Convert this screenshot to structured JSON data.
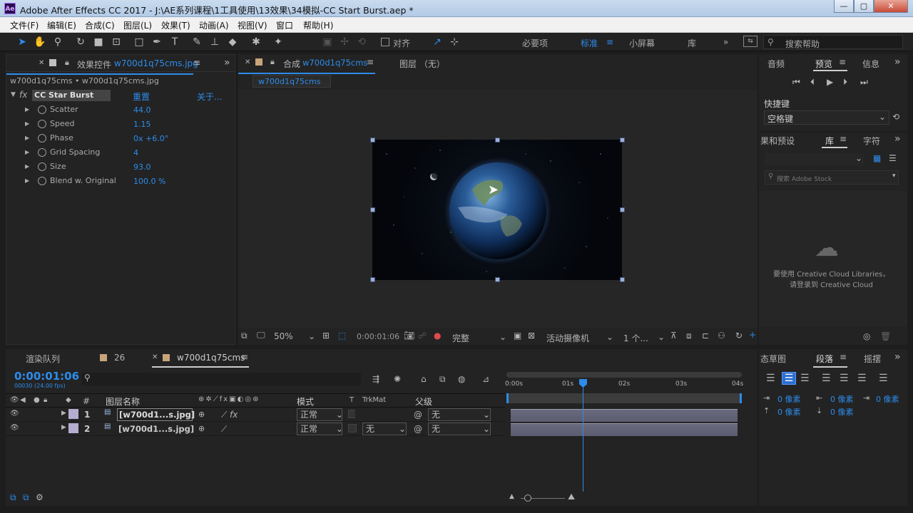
{
  "titlebar": {
    "title": "Adobe After Effects CC 2017 - J:\\AE系列课程\\1工具使用\\13效果\\34模拟-CC Start Burst.aep *",
    "icon": "Ae",
    "minimize": "—",
    "maximize": "▢",
    "close": "✕"
  },
  "menu": [
    "文件(F)",
    "编辑(E)",
    "合成(C)",
    "图层(L)",
    "效果(T)",
    "动画(A)",
    "视图(V)",
    "窗口",
    "帮助(H)"
  ],
  "toolbar": {
    "align_label": "对齐",
    "workspaces": [
      "必要项",
      "标准",
      "小屏幕",
      "库"
    ],
    "active_workspace": "标准",
    "search_placeholder": "搜索帮助"
  },
  "effect_panel": {
    "tab_prefix": "效果控件",
    "tab_name": "w700d1q75cms.jpg",
    "breadcrumb": "w700d1q75cms • w700d1q75cms.jpg",
    "effect_name": "CC Star Burst",
    "reset": "重置",
    "about": "关于...",
    "params": [
      {
        "name": "Scatter",
        "value": "44.0"
      },
      {
        "name": "Speed",
        "value": "1.15"
      },
      {
        "name": "Phase",
        "value": "0x +6.0°"
      },
      {
        "name": "Grid Spacing",
        "value": "4"
      },
      {
        "name": "Size",
        "value": "93.0"
      },
      {
        "name": "Blend w. Original",
        "value": "100.0 %"
      }
    ]
  },
  "comp_panel": {
    "tab_prefix": "合成",
    "tab_name": "w700d1q75cms",
    "layer_tab": "图层 （无）",
    "subtab": "w700d1q75cms",
    "zoom": "50%",
    "timecode": "0:00:01:06",
    "resolution": "完整",
    "camera": "活动摄像机",
    "views": "1 个..."
  },
  "right_panel": {
    "tabs_top": [
      "音频",
      "预览",
      "信息"
    ],
    "active_top": "预览",
    "shortcut_label": "快捷键",
    "shortcut_value": "空格键",
    "tabs_mid": [
      "果和预设",
      "库",
      "字符"
    ],
    "active_mid": "库",
    "stock_placeholder": "搜索 Adobe Stock",
    "cc_msg_line1": "要使用 Creative Cloud Libraries，",
    "cc_msg_line2": "请登录到 Creative Cloud",
    "tabs_bottom": [
      "态草图",
      "段落",
      "摇摆"
    ],
    "active_bottom": "段落",
    "para_values": [
      "0 像素",
      "0 像素",
      "0 像素",
      "0 像素",
      "0 像素"
    ]
  },
  "timeline": {
    "tabs": [
      "渲染队列",
      "26",
      "w700d1q75cms"
    ],
    "timecode": "0:00:01:06",
    "fps": "00030 (24.00 fps)",
    "columns": {
      "num": "#",
      "name": "图层名称",
      "mode": "模式",
      "t": "T",
      "trkmat": "TrkMat",
      "parent": "父级"
    },
    "ruler": [
      "0:00s",
      "01s",
      "02s",
      "03s",
      "04s"
    ],
    "layers": [
      {
        "num": "1",
        "name": "[w700d1...s.jpg]",
        "mode": "正常",
        "trkmat": "",
        "parent": "无"
      },
      {
        "num": "2",
        "name": "[w700d1...s.jpg]",
        "mode": "正常",
        "trkmat": "无",
        "parent": "无"
      }
    ]
  }
}
